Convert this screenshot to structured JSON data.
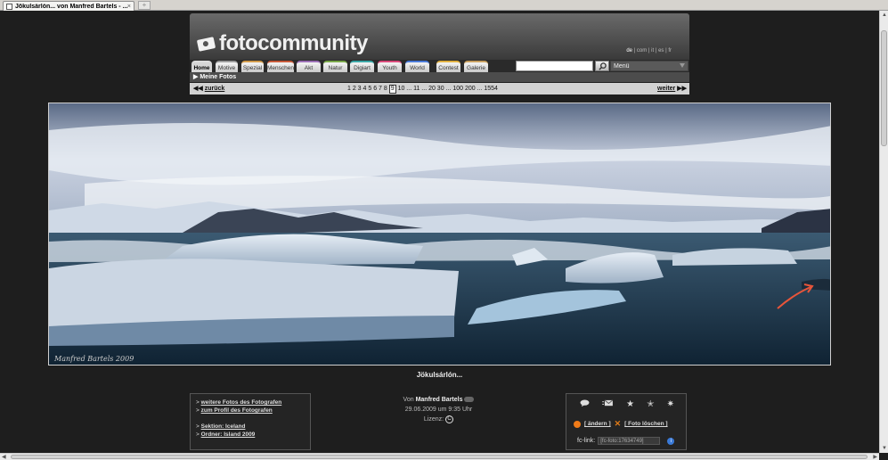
{
  "browser": {
    "tab_title": "Jökulsárlón... von Manfred Bartels - ...",
    "tab_close": "×",
    "new_tab": "+"
  },
  "header": {
    "logo_text": "fotocommunity",
    "languages": [
      "de",
      "com",
      "it",
      "es",
      "fr"
    ],
    "nav_tabs": [
      {
        "label": "Home",
        "color": "#d6d6d6"
      },
      {
        "label": "Motive",
        "color": "#9b9b9b"
      },
      {
        "label": "Spezial",
        "color": "#d19a4a"
      },
      {
        "label": "Menschen",
        "color": "#c75a3a"
      },
      {
        "label": "Akt",
        "color": "#9b6fb5"
      },
      {
        "label": "Natur",
        "color": "#7aa84a"
      },
      {
        "label": "Digiart",
        "color": "#3aa6a6"
      },
      {
        "label": "Youth",
        "color": "#d84a7a"
      },
      {
        "label": "World",
        "color": "#4a7ad8"
      },
      {
        "label": "Contest",
        "color": "#e0b040"
      },
      {
        "label": "Galerie",
        "color": "#c8a060"
      }
    ],
    "search_placeholder": "",
    "menu_label": "Menü",
    "submenu_label": "Meine Fotos"
  },
  "pager": {
    "back_label": "zurück",
    "next_label": "weiter",
    "pages_before": "1 2 3 4 5 6 7 8",
    "current_page": "9",
    "pages_after": "10 ... 11 ... 20 30 ... 100 200 ... 1554"
  },
  "photo": {
    "signature": "Manfred Bartels 2009",
    "caption": "Jökulsárlón..."
  },
  "left_box": {
    "links": [
      "weitere Fotos des Fotografen",
      "zum Profil des Fotografen"
    ],
    "section_label": "Sektion: Iceland",
    "folder_label": "Ordner: Island 2009"
  },
  "center_info": {
    "by_prefix": "Von",
    "author": "Manfred Bartels",
    "date_line": "29.06.2009 um 9:35 Uhr",
    "license_label": "Lizenz:",
    "license_symbol": "C"
  },
  "right_box": {
    "edit_label": "[ ändern ]",
    "delete_label": "[ Foto löschen ]",
    "fclink_label": "fc-link:",
    "fclink_value": "[fc-foto:17634749]",
    "info_symbol": "i"
  }
}
